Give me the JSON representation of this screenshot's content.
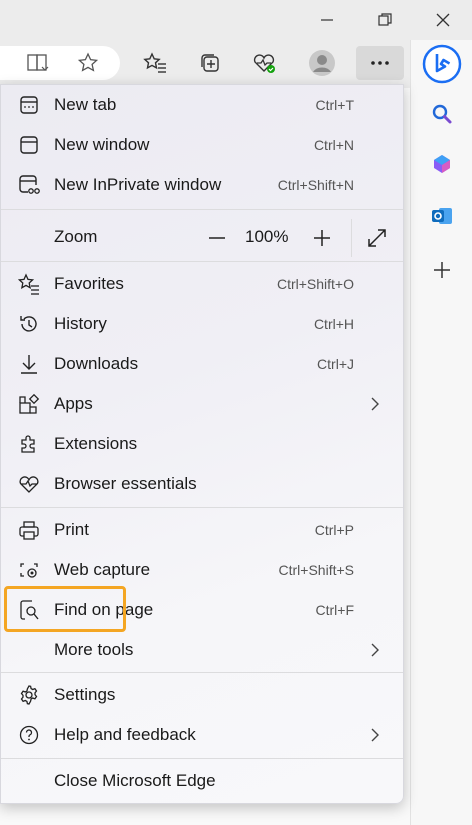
{
  "window_controls": {
    "minimize_icon": "minimize-icon",
    "restore_icon": "restore-icon",
    "close_icon": "close-icon"
  },
  "toolbar": {
    "icons": [
      "reading-view-icon",
      "favorite-star-icon",
      "favorites-icon",
      "collections-icon",
      "browser-essentials-icon",
      "profile-avatar",
      "more-icon"
    ]
  },
  "right_rail": {
    "icons": [
      "bing-icon",
      "search-icon",
      "copilot-icon",
      "outlook-icon",
      "add-icon"
    ]
  },
  "menu": {
    "items_top": [
      {
        "label": "New tab",
        "shortcut": "Ctrl+T",
        "icon": "new-tab-icon"
      },
      {
        "label": "New window",
        "shortcut": "Ctrl+N",
        "icon": "new-window-icon"
      },
      {
        "label": "New InPrivate window",
        "shortcut": "Ctrl+Shift+N",
        "icon": "inprivate-icon"
      }
    ],
    "zoom": {
      "label": "Zoom",
      "value": "100%"
    },
    "items_mid": [
      {
        "label": "Favorites",
        "shortcut": "Ctrl+Shift+O",
        "icon": "favorites-icon"
      },
      {
        "label": "History",
        "shortcut": "Ctrl+H",
        "icon": "history-icon"
      },
      {
        "label": "Downloads",
        "shortcut": "Ctrl+J",
        "icon": "downloads-icon"
      },
      {
        "label": "Apps",
        "shortcut": "",
        "icon": "apps-icon"
      },
      {
        "label": "Extensions",
        "shortcut": "",
        "icon": "extensions-icon"
      },
      {
        "label": "Browser essentials",
        "shortcut": "",
        "icon": "browser-essentials-icon"
      }
    ],
    "items_tools": [
      {
        "label": "Print",
        "shortcut": "Ctrl+P",
        "icon": "print-icon"
      },
      {
        "label": "Web capture",
        "shortcut": "Ctrl+Shift+S",
        "icon": "web-capture-icon"
      },
      {
        "label": "Find on page",
        "shortcut": "Ctrl+F",
        "icon": "find-icon"
      },
      {
        "label": "More tools",
        "shortcut": "",
        "icon": ""
      }
    ],
    "items_bottom": [
      {
        "label": "Settings",
        "shortcut": "",
        "icon": "settings-icon"
      },
      {
        "label": "Help and feedback",
        "shortcut": "",
        "icon": "help-icon"
      }
    ],
    "close": {
      "label": "Close Microsoft Edge"
    }
  },
  "colors": {
    "highlight": "#f4a623",
    "bing_blue": "#1b6ef3",
    "outlook_blue": "#0f6cbd"
  }
}
